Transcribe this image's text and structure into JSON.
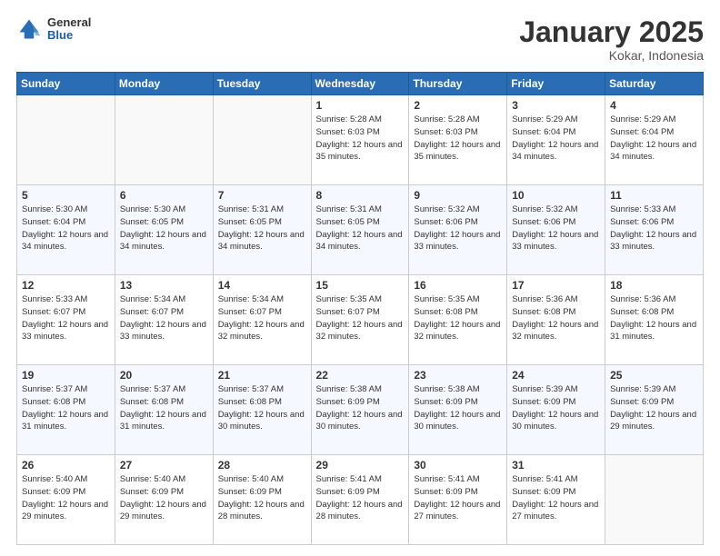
{
  "logo": {
    "general": "General",
    "blue": "Blue"
  },
  "header": {
    "title": "January 2025",
    "subtitle": "Kokar, Indonesia"
  },
  "weekdays": [
    "Sunday",
    "Monday",
    "Tuesday",
    "Wednesday",
    "Thursday",
    "Friday",
    "Saturday"
  ],
  "weeks": [
    [
      {
        "day": "",
        "info": ""
      },
      {
        "day": "",
        "info": ""
      },
      {
        "day": "",
        "info": ""
      },
      {
        "day": "1",
        "info": "Sunrise: 5:28 AM\nSunset: 6:03 PM\nDaylight: 12 hours\nand 35 minutes."
      },
      {
        "day": "2",
        "info": "Sunrise: 5:28 AM\nSunset: 6:03 PM\nDaylight: 12 hours\nand 35 minutes."
      },
      {
        "day": "3",
        "info": "Sunrise: 5:29 AM\nSunset: 6:04 PM\nDaylight: 12 hours\nand 34 minutes."
      },
      {
        "day": "4",
        "info": "Sunrise: 5:29 AM\nSunset: 6:04 PM\nDaylight: 12 hours\nand 34 minutes."
      }
    ],
    [
      {
        "day": "5",
        "info": "Sunrise: 5:30 AM\nSunset: 6:04 PM\nDaylight: 12 hours\nand 34 minutes."
      },
      {
        "day": "6",
        "info": "Sunrise: 5:30 AM\nSunset: 6:05 PM\nDaylight: 12 hours\nand 34 minutes."
      },
      {
        "day": "7",
        "info": "Sunrise: 5:31 AM\nSunset: 6:05 PM\nDaylight: 12 hours\nand 34 minutes."
      },
      {
        "day": "8",
        "info": "Sunrise: 5:31 AM\nSunset: 6:05 PM\nDaylight: 12 hours\nand 34 minutes."
      },
      {
        "day": "9",
        "info": "Sunrise: 5:32 AM\nSunset: 6:06 PM\nDaylight: 12 hours\nand 33 minutes."
      },
      {
        "day": "10",
        "info": "Sunrise: 5:32 AM\nSunset: 6:06 PM\nDaylight: 12 hours\nand 33 minutes."
      },
      {
        "day": "11",
        "info": "Sunrise: 5:33 AM\nSunset: 6:06 PM\nDaylight: 12 hours\nand 33 minutes."
      }
    ],
    [
      {
        "day": "12",
        "info": "Sunrise: 5:33 AM\nSunset: 6:07 PM\nDaylight: 12 hours\nand 33 minutes."
      },
      {
        "day": "13",
        "info": "Sunrise: 5:34 AM\nSunset: 6:07 PM\nDaylight: 12 hours\nand 33 minutes."
      },
      {
        "day": "14",
        "info": "Sunrise: 5:34 AM\nSunset: 6:07 PM\nDaylight: 12 hours\nand 32 minutes."
      },
      {
        "day": "15",
        "info": "Sunrise: 5:35 AM\nSunset: 6:07 PM\nDaylight: 12 hours\nand 32 minutes."
      },
      {
        "day": "16",
        "info": "Sunrise: 5:35 AM\nSunset: 6:08 PM\nDaylight: 12 hours\nand 32 minutes."
      },
      {
        "day": "17",
        "info": "Sunrise: 5:36 AM\nSunset: 6:08 PM\nDaylight: 12 hours\nand 32 minutes."
      },
      {
        "day": "18",
        "info": "Sunrise: 5:36 AM\nSunset: 6:08 PM\nDaylight: 12 hours\nand 31 minutes."
      }
    ],
    [
      {
        "day": "19",
        "info": "Sunrise: 5:37 AM\nSunset: 6:08 PM\nDaylight: 12 hours\nand 31 minutes."
      },
      {
        "day": "20",
        "info": "Sunrise: 5:37 AM\nSunset: 6:08 PM\nDaylight: 12 hours\nand 31 minutes."
      },
      {
        "day": "21",
        "info": "Sunrise: 5:37 AM\nSunset: 6:08 PM\nDaylight: 12 hours\nand 30 minutes."
      },
      {
        "day": "22",
        "info": "Sunrise: 5:38 AM\nSunset: 6:09 PM\nDaylight: 12 hours\nand 30 minutes."
      },
      {
        "day": "23",
        "info": "Sunrise: 5:38 AM\nSunset: 6:09 PM\nDaylight: 12 hours\nand 30 minutes."
      },
      {
        "day": "24",
        "info": "Sunrise: 5:39 AM\nSunset: 6:09 PM\nDaylight: 12 hours\nand 30 minutes."
      },
      {
        "day": "25",
        "info": "Sunrise: 5:39 AM\nSunset: 6:09 PM\nDaylight: 12 hours\nand 29 minutes."
      }
    ],
    [
      {
        "day": "26",
        "info": "Sunrise: 5:40 AM\nSunset: 6:09 PM\nDaylight: 12 hours\nand 29 minutes."
      },
      {
        "day": "27",
        "info": "Sunrise: 5:40 AM\nSunset: 6:09 PM\nDaylight: 12 hours\nand 29 minutes."
      },
      {
        "day": "28",
        "info": "Sunrise: 5:40 AM\nSunset: 6:09 PM\nDaylight: 12 hours\nand 28 minutes."
      },
      {
        "day": "29",
        "info": "Sunrise: 5:41 AM\nSunset: 6:09 PM\nDaylight: 12 hours\nand 28 minutes."
      },
      {
        "day": "30",
        "info": "Sunrise: 5:41 AM\nSunset: 6:09 PM\nDaylight: 12 hours\nand 27 minutes."
      },
      {
        "day": "31",
        "info": "Sunrise: 5:41 AM\nSunset: 6:09 PM\nDaylight: 12 hours\nand 27 minutes."
      },
      {
        "day": "",
        "info": ""
      }
    ]
  ]
}
